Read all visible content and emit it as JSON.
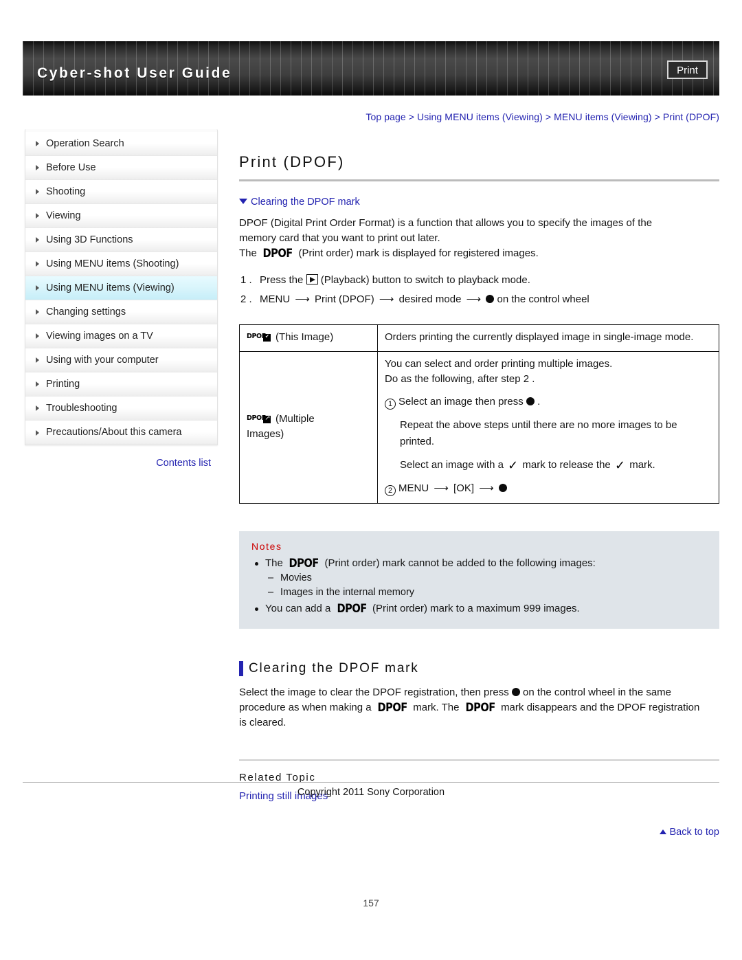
{
  "header": {
    "title": "Cyber-shot User Guide",
    "print_label": "Print"
  },
  "sidebar": {
    "items": [
      {
        "label": "Operation Search",
        "active": false
      },
      {
        "label": "Before Use",
        "active": false
      },
      {
        "label": "Shooting",
        "active": false
      },
      {
        "label": "Viewing",
        "active": false
      },
      {
        "label": "Using 3D Functions",
        "active": false
      },
      {
        "label": "Using MENU items (Shooting)",
        "active": false
      },
      {
        "label": "Using MENU items (Viewing)",
        "active": true
      },
      {
        "label": "Changing settings",
        "active": false
      },
      {
        "label": "Viewing images on a TV",
        "active": false
      },
      {
        "label": "Using with your computer",
        "active": false
      },
      {
        "label": "Printing",
        "active": false
      },
      {
        "label": "Troubleshooting",
        "active": false
      },
      {
        "label": "Precautions/About this camera",
        "active": false
      }
    ],
    "contents_link": "Contents list"
  },
  "main": {
    "breadcrumb": "Top page > Using MENU items (Viewing) > MENU items (Viewing) > Print (DPOF)",
    "page_title": "Print (DPOF)",
    "jump_link": "Clearing the DPOF mark",
    "intro_line1": "DPOF (Digital Print Order Format) is a function that allows you to specify the images of the",
    "intro_line2": "memory card that you want to print out later.",
    "intro_line3_prefix": "The",
    "intro_line3_suffix": "(Print order) mark is displayed for registered images.",
    "dpof_logo": "DPOF",
    "steps": [
      {
        "num": "1 .",
        "text_prefix": "Press the",
        "icon": "playback-icon",
        "text_suffix": "(Playback) button to switch to playback mode."
      },
      {
        "num": "2 .",
        "parts": [
          "MENU",
          "Print (DPOF)",
          "desired mode"
        ],
        "tail": "on the control wheel"
      }
    ],
    "table": {
      "rows": [
        {
          "mode_label": "(This Image)",
          "icon_glyph": "check-badge",
          "description": "Orders printing the currently displayed image in single-image mode."
        },
        {
          "mode_label_line1": "(Multiple",
          "mode_label_line2": "Images)",
          "icon_glyph": "arrow-badge",
          "desc_line1": "You can select and order printing multiple images.",
          "desc_line2": "Do as the following, after step 2 .",
          "sub_steps": [
            {
              "num": "1",
              "text_prefix": "Select an image then press",
              "text_suffix": "."
            },
            {
              "text": "Repeat the above steps until there are no more images to be"
            },
            {
              "text": "printed."
            },
            {
              "pre": "Select an image with a",
              "mid": "mark to release the",
              "post": "mark."
            },
            {
              "num": "2",
              "parts": [
                "MENU",
                "[OK]"
              ]
            }
          ]
        }
      ]
    },
    "notes": {
      "title": "Notes",
      "items": [
        {
          "prefix": "The",
          "suffix": "(Print order) mark cannot be added to the following images:",
          "sub": [
            "Movies",
            "Images in the internal memory"
          ]
        },
        {
          "prefix": "You can add a",
          "suffix": "(Print order) mark to a maximum 999 images."
        }
      ]
    },
    "sub_heading": "Clearing the DPOF mark",
    "clearing_para": {
      "part1": "Select the image to clear the DPOF registration, then press",
      "part2": "on the control wheel in the same",
      "part3": "procedure as when making a",
      "part4": "mark. The",
      "part5": "mark disappears and the DPOF registration",
      "part6": "is cleared."
    },
    "related": {
      "title": "Related Topic",
      "link": "Printing still images"
    },
    "back_to_top": "Back to top"
  },
  "footer": {
    "copyright": "Copyright 2011 Sony Corporation",
    "page_number": "157"
  },
  "colors": {
    "link": "#2323b0",
    "notes_title": "#cc0000",
    "notes_bg": "#dfe4e9",
    "active_sidebar": "#d7f4fb",
    "accent_bar": "#2323b0"
  }
}
